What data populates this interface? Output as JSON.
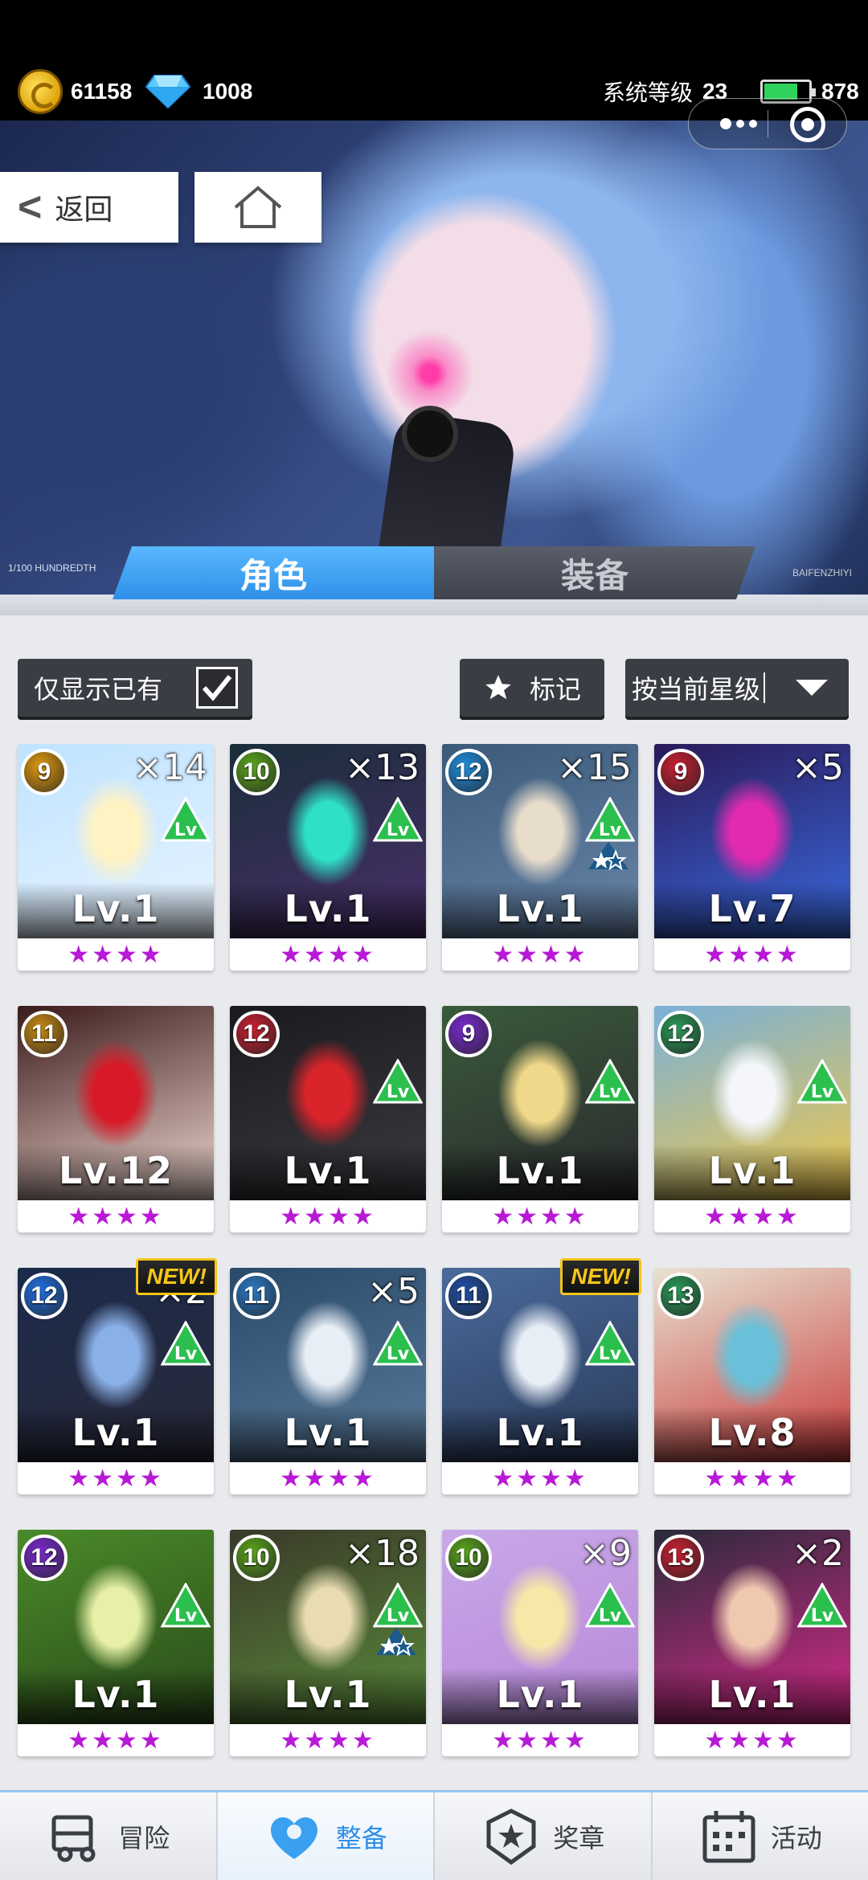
{
  "status": {
    "coins": "61158",
    "gems": "1008",
    "system_level_label": "系统等级",
    "system_level_value": "23",
    "energy": "878"
  },
  "header": {
    "back_label": "返回"
  },
  "tabs": {
    "roles": "角色",
    "equipment": "装备",
    "deco_left": "1/100 HUNDREDTH",
    "deco_right": "BAIFENZHIYI"
  },
  "filters": {
    "owned_only_label": "仅显示已有",
    "owned_only_checked": true,
    "mark_label": "标记",
    "sort_label": "按当前星级"
  },
  "cards": [
    {
      "rank": "9",
      "copies": "×14",
      "level": "Lv.1",
      "stars": "★★★★",
      "lvup": true,
      "new": false,
      "star_badge": false,
      "rank_color": "#e09a0e",
      "art": [
        "#bfe3ff",
        "#fff3c4",
        "#e9f4ff"
      ]
    },
    {
      "rank": "10",
      "copies": "×13",
      "level": "Lv.1",
      "stars": "★★★★",
      "lvup": true,
      "new": false,
      "star_badge": false,
      "rank_color": "#5aa61c",
      "art": [
        "#1a2e3a",
        "#2fe0c8",
        "#4a2f6a"
      ]
    },
    {
      "rank": "12",
      "copies": "×15",
      "level": "Lv.1",
      "stars": "★★★★",
      "lvup": true,
      "new": false,
      "star_badge": true,
      "rank_color": "#1f8fe0",
      "art": [
        "#3b5a7a",
        "#e8dccb",
        "#6a86a8"
      ]
    },
    {
      "rank": "9",
      "copies": "×5",
      "level": "Lv.7",
      "stars": "★★★★",
      "lvup": false,
      "new": false,
      "star_badge": false,
      "rank_color": "#c81f32",
      "art": [
        "#2a1a5a",
        "#e02ab0",
        "#3a6ae0"
      ]
    },
    {
      "rank": "11",
      "copies": "",
      "level": "Lv.12",
      "stars": "★★★★",
      "lvup": false,
      "new": false,
      "star_badge": false,
      "rank_color": "#c88a14",
      "art": [
        "#3a1a1a",
        "#d81a28",
        "#f0d8d0"
      ]
    },
    {
      "rank": "12",
      "copies": "",
      "level": "Lv.1",
      "stars": "★★★★",
      "lvup": true,
      "new": false,
      "star_badge": false,
      "rank_color": "#c81f32",
      "art": [
        "#1a1a1e",
        "#d8242a",
        "#3a3a40"
      ]
    },
    {
      "rank": "9",
      "copies": "",
      "level": "Lv.1",
      "stars": "★★★★",
      "lvup": true,
      "new": false,
      "star_badge": false,
      "rank_color": "#7a2ad0",
      "art": [
        "#3a5a3a",
        "#f0d88a",
        "#2a2a2e"
      ]
    },
    {
      "rank": "12",
      "copies": "",
      "level": "Lv.1",
      "stars": "★★★★",
      "lvup": true,
      "new": false,
      "star_badge": false,
      "rank_color": "#2a9a58",
      "art": [
        "#7ab0d8",
        "#f4f6fa",
        "#f0c84a"
      ]
    },
    {
      "rank": "12",
      "copies": "×2",
      "level": "Lv.1",
      "stars": "★★★★",
      "lvup": true,
      "new": true,
      "star_badge": false,
      "rank_color": "#1f6fe0",
      "art": [
        "#1a2a4a",
        "#8ab0e8",
        "#2a2a3a"
      ]
    },
    {
      "rank": "11",
      "copies": "×5",
      "level": "Lv.1",
      "stars": "★★★★",
      "lvup": true,
      "new": false,
      "star_badge": false,
      "rank_color": "#2a7ac8",
      "art": [
        "#2a4a6a",
        "#e8eef6",
        "#5a7a9a"
      ]
    },
    {
      "rank": "11",
      "copies": "",
      "level": "Lv.1",
      "stars": "★★★★",
      "lvup": true,
      "new": true,
      "star_badge": false,
      "rank_color": "#1f4fa8",
      "art": [
        "#4a6a9a",
        "#e8eef6",
        "#2a3a5a"
      ]
    },
    {
      "rank": "13",
      "copies": "",
      "level": "Lv.8",
      "stars": "★★★★",
      "lvup": false,
      "new": false,
      "star_badge": false,
      "rank_color": "#2a9a58",
      "art": [
        "#e8e2d2",
        "#6ac0d8",
        "#c83a3a"
      ]
    },
    {
      "rank": "12",
      "copies": "",
      "level": "Lv.1",
      "stars": "★★★★",
      "lvup": true,
      "new": false,
      "star_badge": false,
      "rank_color": "#7a2ad0",
      "art": [
        "#4a8a2a",
        "#e8f0a8",
        "#2a4a1a"
      ]
    },
    {
      "rank": "10",
      "copies": "×18",
      "level": "Lv.1",
      "stars": "★★★★",
      "lvup": true,
      "new": false,
      "star_badge": true,
      "rank_color": "#5aa61c",
      "art": [
        "#3a3a2a",
        "#e8dcb0",
        "#5a8a3a"
      ]
    },
    {
      "rank": "10",
      "copies": "×9",
      "level": "Lv.1",
      "stars": "★★★★",
      "lvup": true,
      "new": false,
      "star_badge": false,
      "rank_color": "#5aa61c",
      "art": [
        "#c8a8e8",
        "#f8e8a8",
        "#b888d8"
      ]
    },
    {
      "rank": "13",
      "copies": "×2",
      "level": "Lv.1",
      "stars": "★★★★",
      "lvup": true,
      "new": false,
      "star_badge": false,
      "rank_color": "#c81f32",
      "art": [
        "#2a2a3a",
        "#f0c8b0",
        "#d82a8a"
      ]
    }
  ],
  "new_badge_label": "NEW!",
  "bottom_nav": [
    {
      "label": "冒险",
      "icon": "truck-icon",
      "active": false
    },
    {
      "label": "整备",
      "icon": "heart-badge-icon",
      "active": true
    },
    {
      "label": "奖章",
      "icon": "star-shield-icon",
      "active": false
    },
    {
      "label": "活动",
      "icon": "calendar-icon",
      "active": false
    }
  ]
}
